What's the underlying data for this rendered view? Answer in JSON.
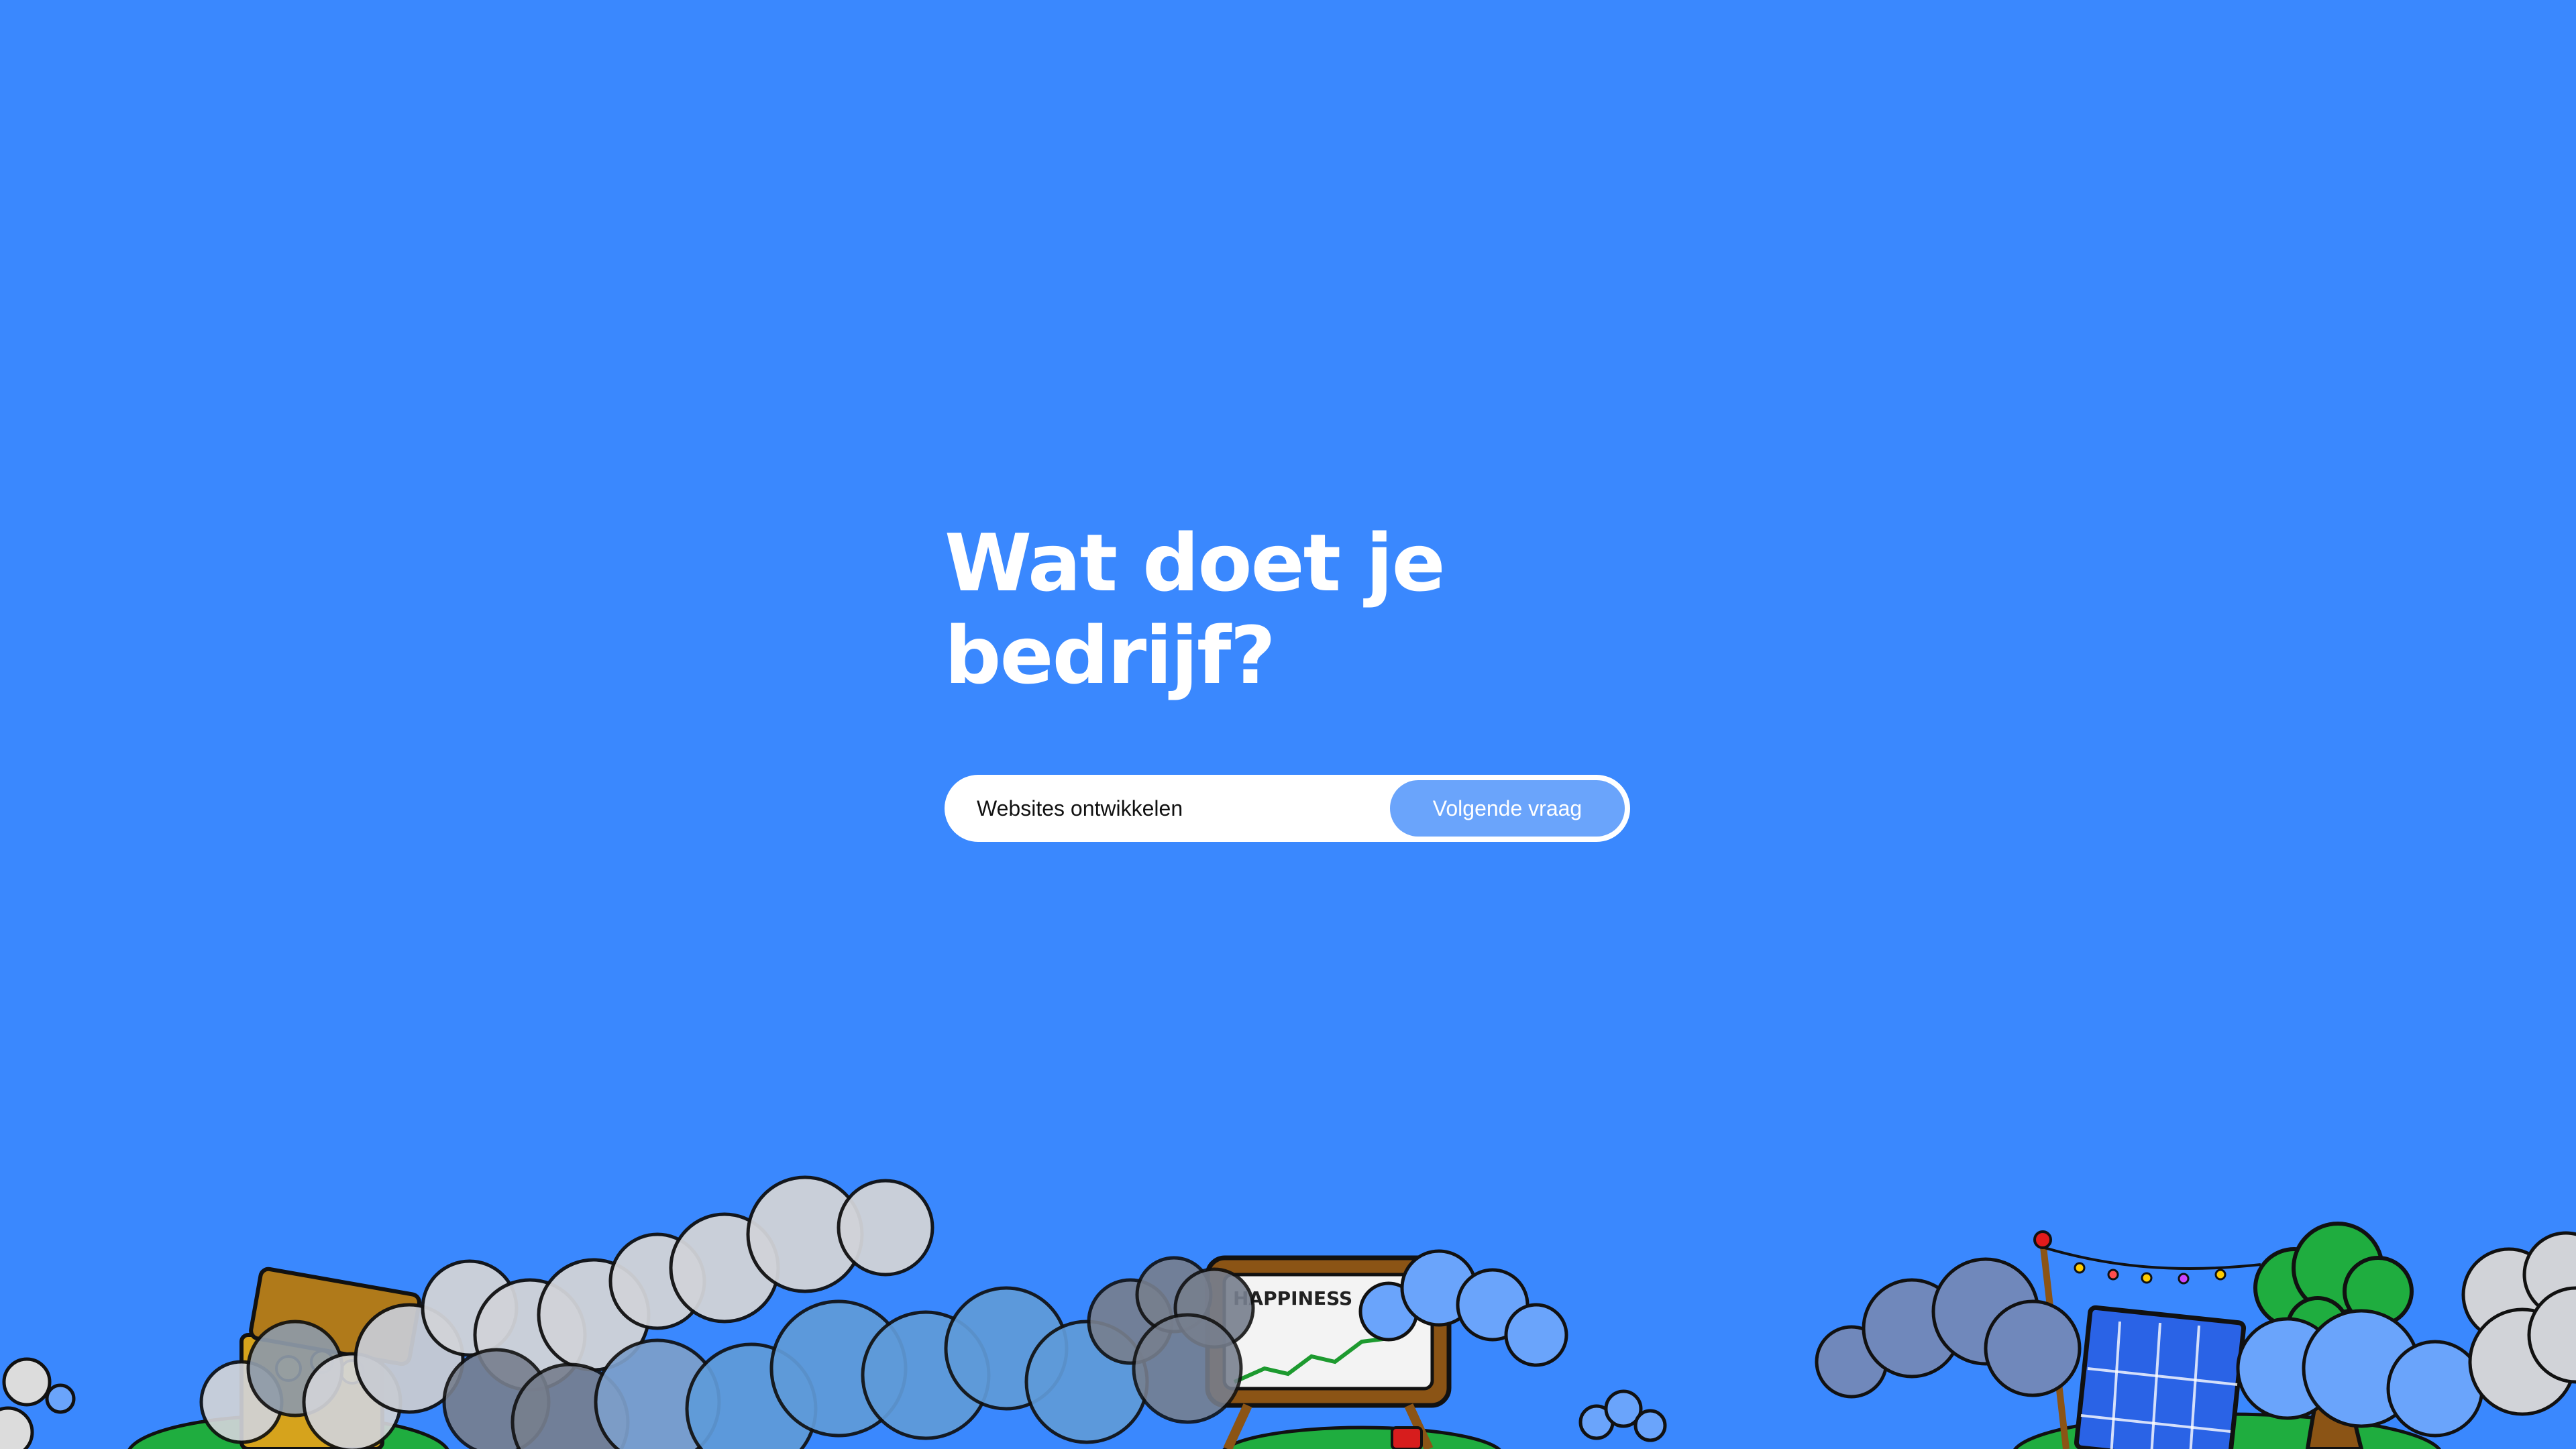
{
  "question": {
    "line1": "Wat doet je",
    "line2": "bedrijf?"
  },
  "answer": {
    "value": "Websites ontwikkelen",
    "placeholder": ""
  },
  "next_button": {
    "label": "Volgende vraag"
  },
  "scenery": {
    "board_text": "HAPPINESS"
  },
  "colors": {
    "background": "#3a88fe",
    "button": "#6aa4fb",
    "input": "#ffffff",
    "text_light": "#ffffff"
  }
}
